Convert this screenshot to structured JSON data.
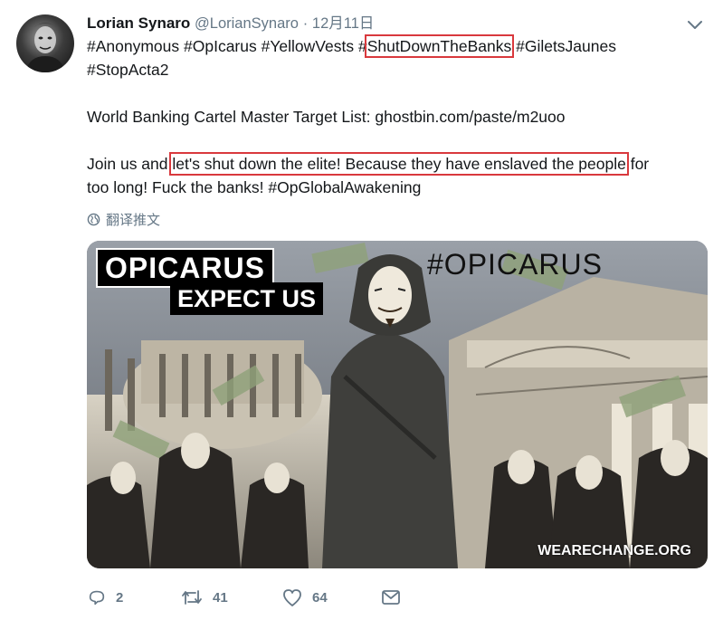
{
  "tweet": {
    "author_name": "Lorian Synaro",
    "author_handle": "@LorianSynaro",
    "separator": "·",
    "timestamp": "12月11日",
    "text": {
      "hashtags_line1": {
        "before": "#Anonymous #OpIcarus #YellowVests #",
        "highlighted": "ShutDownTheBanks",
        "after": " #GiletsJaunes"
      },
      "hashtags_line2": "#StopActa2",
      "target_line": "World Banking Cartel Master Target List: ghostbin.com/paste/m2uoo",
      "join_line": {
        "before": "Join us and ",
        "highlighted": "let's shut down the elite! Because they have enslaved the people",
        "after": " for"
      },
      "join_line2": "too long! Fuck the banks! #OpGlobalAwakening"
    },
    "translate_label": "翻译推文",
    "media": {
      "banner_title": "OPICARUS",
      "banner_subtitle": "EXPECT US",
      "hashtag_overlay": "#OPICARUS",
      "watermark": "WEARECHANGE.ORG"
    },
    "actions": {
      "replies": "2",
      "retweets": "41",
      "likes": "64"
    }
  },
  "colors": {
    "highlight_border": "#d9393d",
    "muted_text": "#657786",
    "primary_text": "#14171a"
  },
  "icons": [
    "caret-down-icon",
    "globe-icon",
    "reply-icon",
    "retweet-icon",
    "heart-icon",
    "dm-icon"
  ]
}
